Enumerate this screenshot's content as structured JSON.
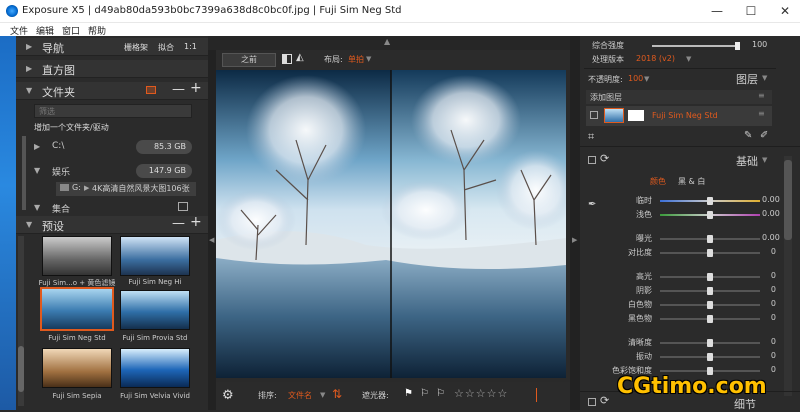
{
  "window": {
    "title": "Exposure X5 | d49ab80da593b0bc7399a638d8c0bc0f.jpg | Fuji Sim Neg Std"
  },
  "window_controls": [
    "—",
    "☐",
    "✕"
  ],
  "menu": [
    "文件",
    "编辑",
    "窗口",
    "帮助"
  ],
  "left": {
    "nav": {
      "title": "导航",
      "opt1": "栅格架",
      "opt2": "拟合",
      "opt3": "1:1"
    },
    "histogram": {
      "title": "直方图"
    },
    "folders": {
      "title": "文件夹",
      "filter_placeholder": "筛选",
      "add_folder": "增加一个文件夹/驱动",
      "drives": [
        {
          "name": "C:\\",
          "size": "85.3 GB"
        },
        {
          "name": "娱乐",
          "size": "147.9 GB"
        }
      ],
      "subfolder": "G:",
      "subfolder_item": "4K高清自然风景大图106张",
      "collection": "集合"
    },
    "presets": {
      "title": "预设",
      "items": [
        {
          "name": "Fuji Sim...o + 黄色滤镜"
        },
        {
          "name": "Fuji Sim Neg Hi"
        },
        {
          "name": "Fuji Sim Neg Std"
        },
        {
          "name": "Fuji Sim Provia Std"
        },
        {
          "name": "Fuji Sim Sepia"
        },
        {
          "name": "Fuji Sim Velvia Vivid"
        }
      ]
    }
  },
  "center": {
    "before_label": "之前",
    "layout_label": "布局:",
    "layout_value": "单拍",
    "sort_label": "排序:",
    "sort_value": "文件名",
    "filter_label": "遮光器:",
    "stars": "☆☆☆☆☆",
    "accent": "#e05a1e"
  },
  "right": {
    "strength_label": "综合强度",
    "strength_value": "100",
    "strength_level": 1.0,
    "process_label": "处理版本",
    "process_value": "2018 (v2)",
    "opacity_label": "不透明度:",
    "opacity_value": "100",
    "layers_title": "图层",
    "add_layer": "添加图层",
    "layer_name": "Fuji Sim Neg Std",
    "basic_title": "基础",
    "color_tab": "颜色",
    "bw_tab": "黑 & 白",
    "sliders": [
      {
        "name": "临时",
        "value": "0.00"
      },
      {
        "name": "浅色",
        "value": "0.00"
      },
      {
        "name": "曝光",
        "value": "0.00"
      },
      {
        "name": "对比度",
        "value": "0"
      },
      {
        "name": "高光",
        "value": "0"
      },
      {
        "name": "阴影",
        "value": "0"
      },
      {
        "name": "白色物",
        "value": "0"
      },
      {
        "name": "黑色物",
        "value": "0"
      },
      {
        "name": "清晰度",
        "value": "0"
      },
      {
        "name": "振动",
        "value": "0"
      },
      {
        "name": "色彩饱和度",
        "value": "0"
      }
    ],
    "detail_title": "细节"
  },
  "watermark": {
    "text": "CGtimo.com"
  }
}
